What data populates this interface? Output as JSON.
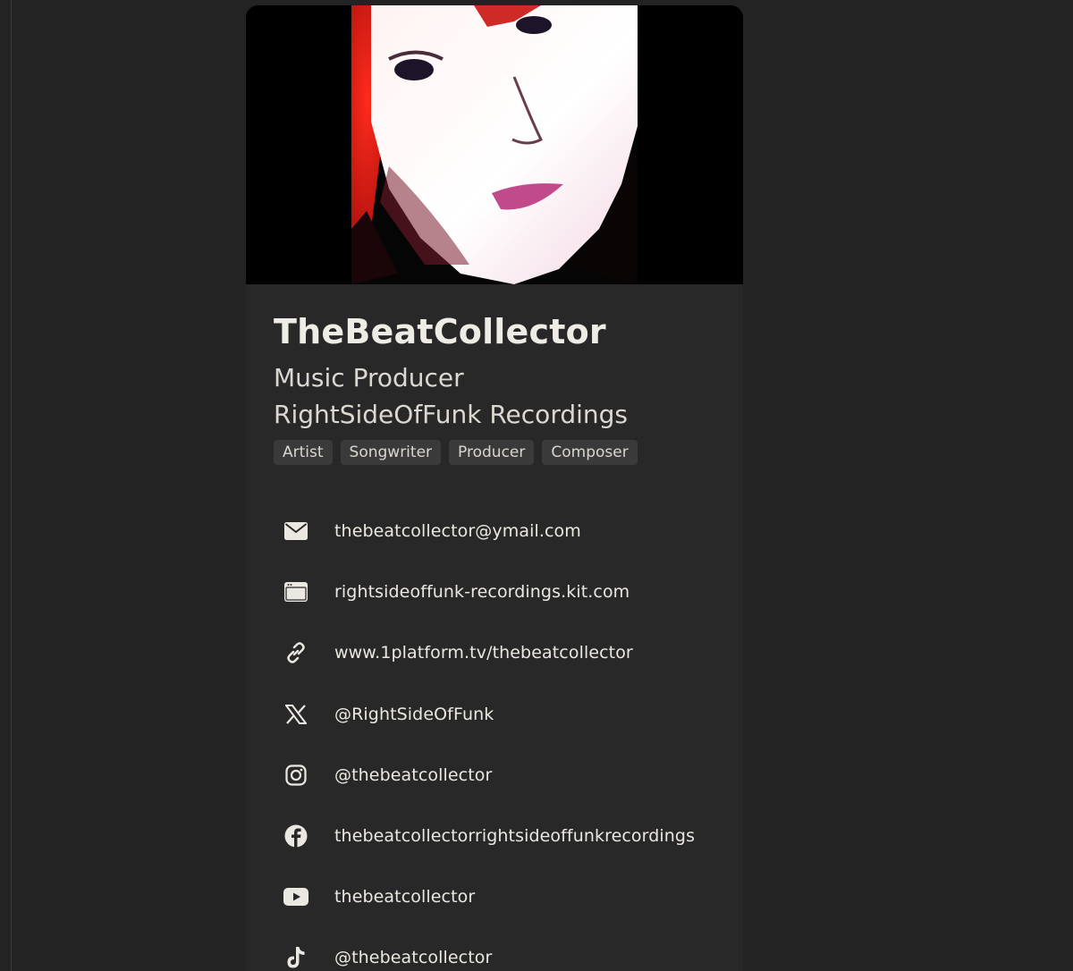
{
  "profile": {
    "name": "TheBeatCollector",
    "role": "Music Producer",
    "label": "RightSideOfFunk Recordings",
    "cover_image": "portrait-photo",
    "tags": [
      "Artist",
      "Songwriter",
      "Producer",
      "Composer"
    ]
  },
  "links": [
    {
      "icon": "mail-icon",
      "text": "thebeatcollector@ymail.com"
    },
    {
      "icon": "website-icon",
      "text": "rightsideoffunk-recordings.kit.com"
    },
    {
      "icon": "link-icon",
      "text": "www.1platform.tv/thebeatcollector"
    },
    {
      "icon": "x-icon",
      "text": "@RightSideOfFunk"
    },
    {
      "icon": "instagram-icon",
      "text": "@thebeatcollector"
    },
    {
      "icon": "facebook-icon",
      "text": "thebeatcollectorrightsideoffunkrecordings"
    },
    {
      "icon": "youtube-icon",
      "text": "thebeatcollector"
    },
    {
      "icon": "tiktok-icon",
      "text": "@thebeatcollector"
    }
  ],
  "colors": {
    "background": "#232323",
    "card": "#282828",
    "tag_bg": "#3a3a3a",
    "text": "#ebe8e2"
  }
}
